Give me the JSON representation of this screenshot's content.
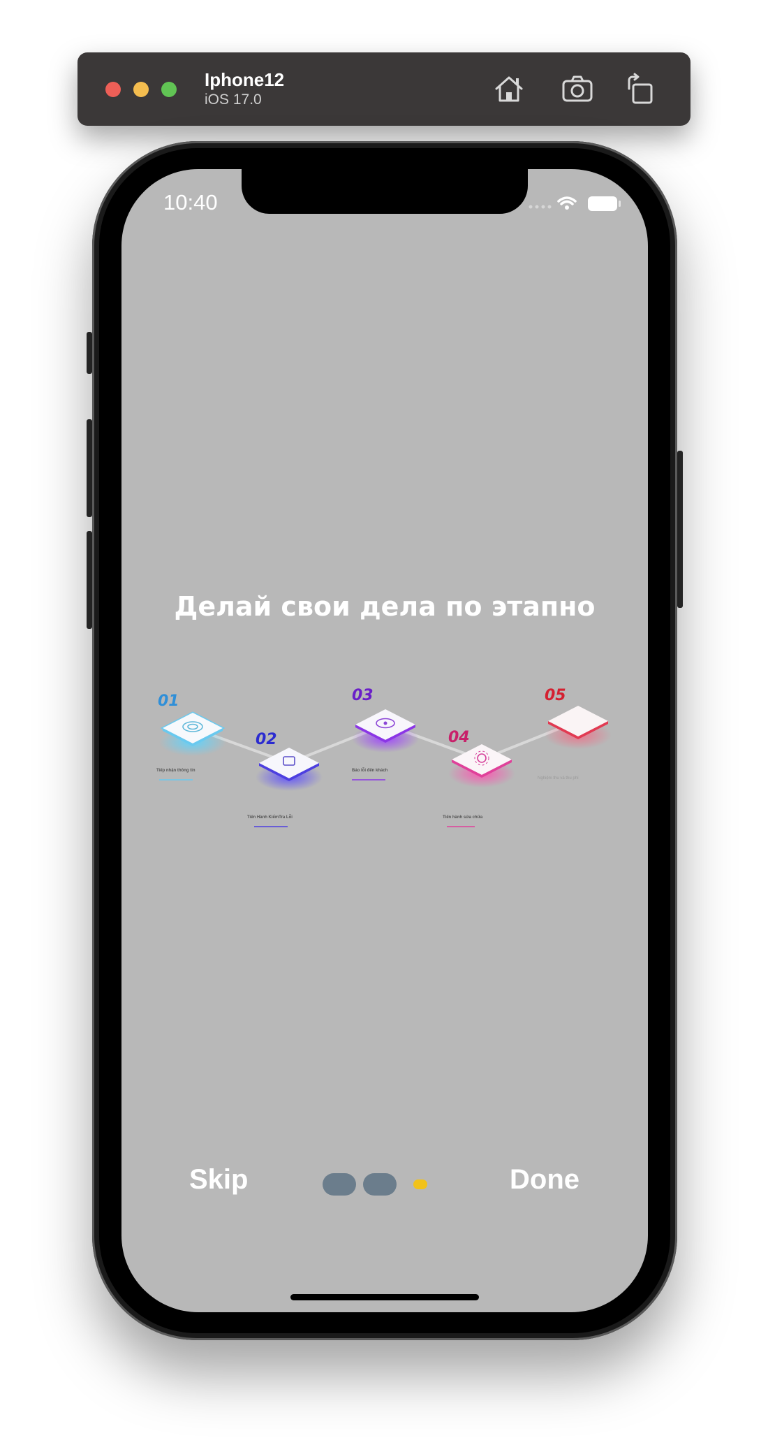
{
  "simulator": {
    "device_name": "Iphone12",
    "os_version": "iOS 17.0",
    "toolbar_icons": [
      "home-icon",
      "screenshot-icon",
      "rotate-icon"
    ]
  },
  "status_bar": {
    "time": "10:40",
    "icons": [
      "signal-icon",
      "wifi-icon",
      "battery-icon"
    ]
  },
  "onboarding": {
    "headline": "Делай свои дела по этапно",
    "steps": [
      {
        "number": "01",
        "caption": "Tiếp nhận thông tin",
        "color": "#2f8fd8"
      },
      {
        "number": "02",
        "caption": "Tiến Hành KiểmTra Lỗi",
        "color": "#2b2bd0"
      },
      {
        "number": "03",
        "caption": "Báo lỗi đến khách",
        "color": "#6a1fc8"
      },
      {
        "number": "04",
        "caption": "Tiến hành sửa chữa",
        "color": "#c8206a"
      },
      {
        "number": "05",
        "caption": "Nghiệm thu và thu phí",
        "color": "#d42030"
      }
    ],
    "skip_label": "Skip",
    "done_label": "Done",
    "page_count": 3,
    "active_page": 3,
    "colors": {
      "background": "#b8b8b8",
      "dot_inactive": "#6b7d8c",
      "dot_active": "#f1c21b"
    }
  }
}
